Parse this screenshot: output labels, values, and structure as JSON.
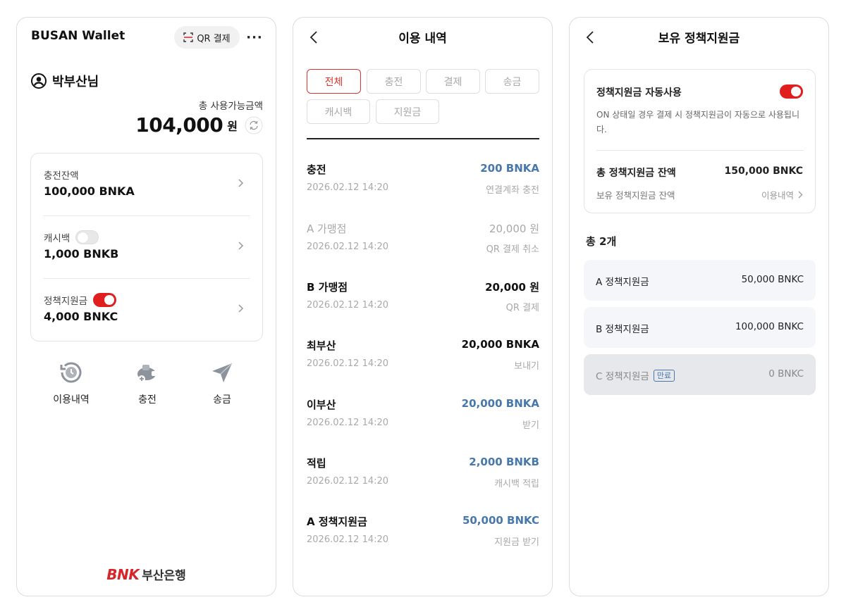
{
  "wallet": {
    "title": "BUSAN Wallet",
    "qr_button": "QR 결제",
    "more": "···",
    "user_name": "박부산님",
    "total_label": "총 사용가능금액",
    "total_amount": "104,000",
    "total_unit": "원",
    "balances": [
      {
        "label": "충전잔액",
        "value": "100,000 BNKA",
        "toggle": null
      },
      {
        "label": "캐시백",
        "value": "1,000 BNKB",
        "toggle": "off"
      },
      {
        "label": "정책지원금",
        "value": "4,000 BNKC",
        "toggle": "on"
      }
    ],
    "actions": [
      {
        "label": "이용내역",
        "icon": "history-icon"
      },
      {
        "label": "충전",
        "icon": "charge-icon"
      },
      {
        "label": "송금",
        "icon": "send-icon"
      }
    ],
    "logo_brand": "BNK",
    "logo_bank": "부산은행"
  },
  "history": {
    "title": "이용 내역",
    "filters": [
      "전체",
      "충전",
      "결제",
      "송금",
      "캐시백",
      "지원금"
    ],
    "active_filter": "전체",
    "items": [
      {
        "name": "충전",
        "amount": "200 BNKA",
        "date": "2026.02.12 14:20",
        "desc": "연결계좌 충전",
        "style": "blue"
      },
      {
        "name": "A 가맹점",
        "amount": "20,000 원",
        "date": "2026.02.12 14:20",
        "desc": "QR 결제 취소",
        "style": "muted"
      },
      {
        "name": "B 가맹점",
        "amount": "20,000 원",
        "date": "2026.02.12 14:20",
        "desc": "QR 결제",
        "style": "normal"
      },
      {
        "name": "최부산",
        "amount": "20,000 BNKA",
        "date": "2026.02.12 14:20",
        "desc": "보내기",
        "style": "normal"
      },
      {
        "name": "이부산",
        "amount": "20,000 BNKA",
        "date": "2026.02.12 14:20",
        "desc": "받기",
        "style": "blue"
      },
      {
        "name": "적립",
        "amount": "2,000 BNKB",
        "date": "2026.02.12 14:20",
        "desc": "캐시백 적립",
        "style": "blue"
      },
      {
        "name": "A 정책지원금",
        "amount": "50,000 BNKC",
        "date": "2026.02.12 14:20",
        "desc": "지원금 받기",
        "style": "blue"
      }
    ]
  },
  "policy": {
    "title": "보유 정책지원금",
    "auto_use_label": "정책지원금 자동사용",
    "auto_use_toggle": "on",
    "auto_use_desc": "ON 상태일 경우 결제 시 정책지원금이 자동으로 사용됩니다.",
    "total_label": "총 정책지원금 잔액",
    "total_value": "150,000 BNKC",
    "sub_label": "보유 정책지원금 잔액",
    "link_label": "이용내역",
    "count_label": "총 2개",
    "funds": [
      {
        "name": "A 정책지원금",
        "value": "50,000 BNKC",
        "badge": ""
      },
      {
        "name": "B 정책지원금",
        "value": "100,000 BNKC",
        "badge": ""
      },
      {
        "name": "C 정책지원금",
        "value": "0 BNKC",
        "badge": "만료"
      }
    ]
  },
  "colors": {
    "accent_red": "#e01e1e",
    "amount_blue": "#4678ac",
    "muted_text": "#a9a9a9",
    "fund_bg": "#f4f6fa"
  }
}
